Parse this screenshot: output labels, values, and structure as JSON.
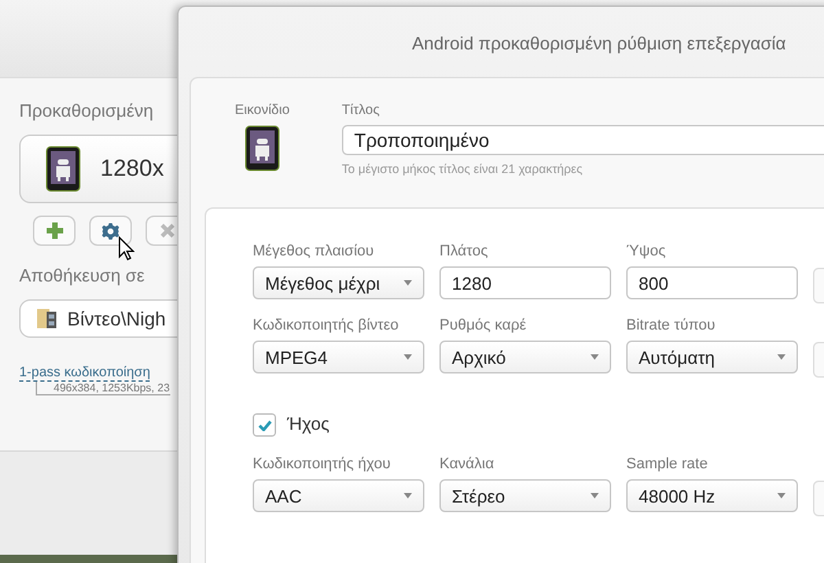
{
  "back_window": {
    "preset_label": "Προκαθορισμένη",
    "preset_value": "1280x",
    "tools": [
      {
        "kind": "add"
      },
      {
        "kind": "settings"
      },
      {
        "kind": "remove"
      }
    ],
    "save_label": "Αποθήκευση σε",
    "save_path": "Βίντεο\\Nigh",
    "encoding_link": "1-pass κωδικοποίηση",
    "encoding_details": "496x384, 1253Kbps, 23"
  },
  "dialog": {
    "title": "Android προκαθορισμένη ρύθμιση επεξεργασία",
    "icon_label": "Εικονίδιο",
    "title_label": "Τίτλος",
    "title_value": "Τροποποιημένο",
    "title_hint": "Το μέγιστο μήκος τίτλος είναι 21 χαρακτήρες"
  },
  "video_rows": [
    [
      {
        "kind": "select",
        "label": "Μέγεθος πλαισίου",
        "value": "Μέγεθος μέχρι"
      },
      {
        "kind": "input",
        "label": "Πλάτος",
        "value": "1280"
      },
      {
        "kind": "input",
        "label": "Ύψος",
        "value": "800"
      },
      {
        "kind": "clipped"
      }
    ],
    [
      {
        "kind": "select",
        "label": "Κωδικοποιητής βίντεο",
        "value": "MPEG4"
      },
      {
        "kind": "select",
        "label": "Ρυθμός καρέ",
        "value": "Αρχικό"
      },
      {
        "kind": "select",
        "label": "Bitrate τύπου",
        "value": "Αυτόματη"
      },
      {
        "kind": "clipped"
      }
    ]
  ],
  "audio": {
    "label": "Ήχος",
    "checked": true
  },
  "audio_rows": [
    [
      {
        "kind": "select",
        "label": "Κωδικοποιητής ήχου",
        "value": "AAC"
      },
      {
        "kind": "select",
        "label": "Κανάλια",
        "value": "Στέρεο"
      },
      {
        "kind": "select",
        "label": "Sample rate",
        "value": "48000 Hz"
      },
      {
        "kind": "clipped"
      }
    ]
  ]
}
